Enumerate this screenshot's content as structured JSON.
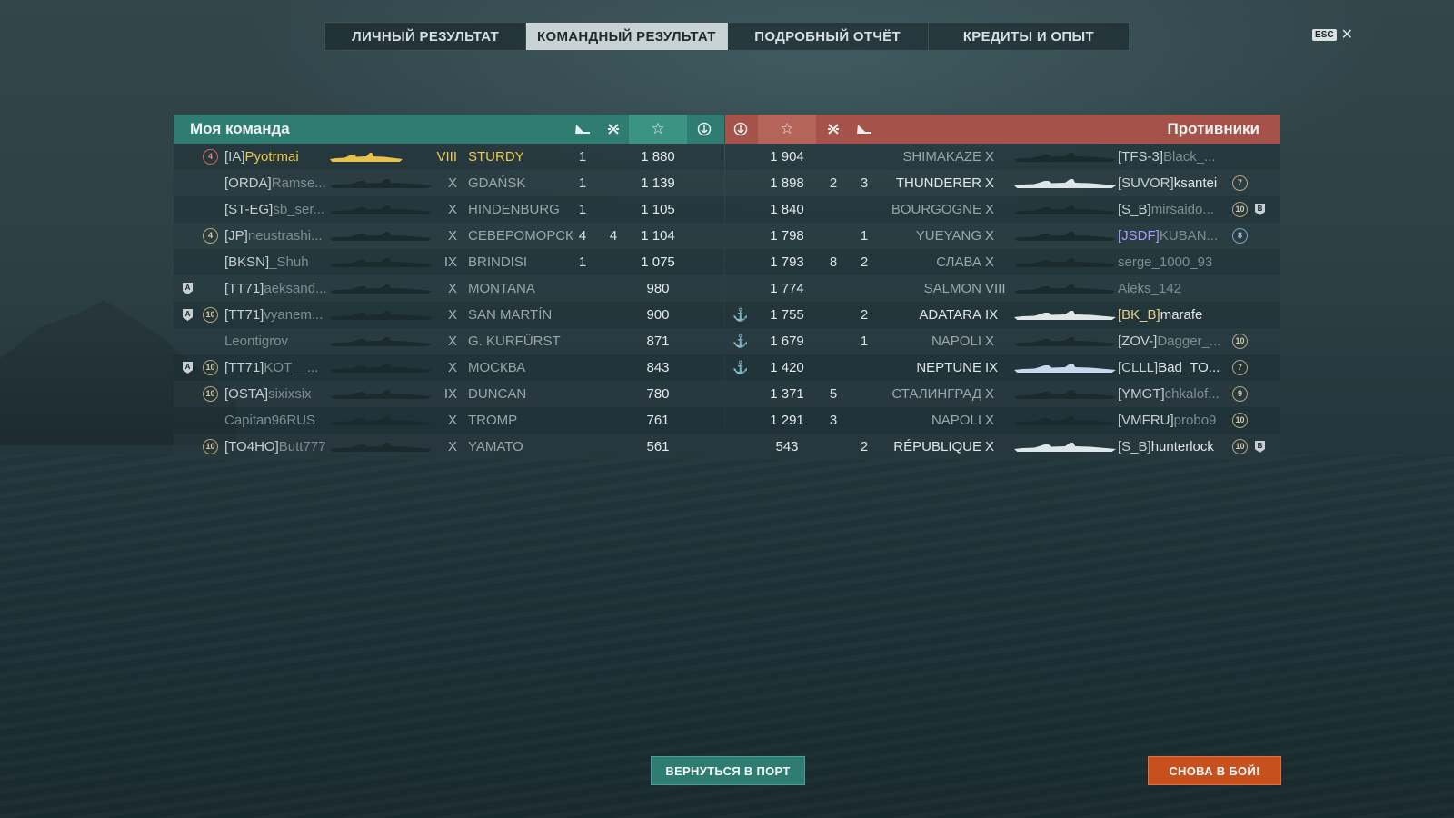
{
  "tabs": [
    {
      "label": "ЛИЧНЫЙ РЕЗУЛЬТАТ",
      "active": false
    },
    {
      "label": "КОМАНДНЫЙ РЕЗУЛЬТАТ",
      "active": true
    },
    {
      "label": "ПОДРОБНЫЙ ОТЧЁТ",
      "active": false
    },
    {
      "label": "КРЕДИТЫ И ОПЫТ",
      "active": false
    }
  ],
  "esc": {
    "key": "ESC",
    "close": "✕"
  },
  "my_team": {
    "title": "Моя команда",
    "color": "#2f7c72",
    "players": [
      {
        "clan": "[IA]",
        "name": "Pyotrmai",
        "tier": "VIII",
        "ship": "STURDY",
        "kills": "1",
        "planes": "",
        "score": "1 880",
        "medal": "4",
        "medal_style": "red",
        "badge": "",
        "self": true
      },
      {
        "clan": "[ORDA]",
        "name": "Ramse...",
        "tier": "X",
        "ship": "GDAŃSK",
        "kills": "1",
        "planes": "",
        "score": "1 139",
        "medal": "",
        "medal_style": "",
        "badge": "",
        "self": false
      },
      {
        "clan": "[ST-EG]",
        "name": "sb_ser...",
        "tier": "X",
        "ship": "HINDENBURG",
        "kills": "1",
        "planes": "",
        "score": "1 105",
        "medal": "",
        "medal_style": "",
        "badge": "",
        "self": false
      },
      {
        "clan": "[JP]",
        "name": "neustrashi...",
        "tier": "X",
        "ship": "СЕВЕРОМОРСК",
        "kills": "4",
        "planes": "4",
        "score": "1 104",
        "medal": "4",
        "medal_style": "",
        "badge": "",
        "self": false
      },
      {
        "clan": "[BKSN]",
        "name": "_Shuh",
        "tier": "IX",
        "ship": "BRINDISI",
        "kills": "1",
        "planes": "",
        "score": "1 075",
        "medal": "",
        "medal_style": "",
        "badge": "",
        "self": false
      },
      {
        "clan": "[TT71]",
        "name": "aeksand...",
        "tier": "X",
        "ship": "MONTANA",
        "kills": "",
        "planes": "",
        "score": "980",
        "medal": "",
        "medal_style": "",
        "badge": "A",
        "self": false
      },
      {
        "clan": "[TT71]",
        "name": "vyanem...",
        "tier": "X",
        "ship": "SAN MARTÍN",
        "kills": "",
        "planes": "",
        "score": "900",
        "medal": "10",
        "medal_style": "",
        "badge": "A",
        "self": false
      },
      {
        "clan": "",
        "name": "Leontigrov",
        "tier": "X",
        "ship": "G. KURFÜRST",
        "kills": "",
        "planes": "",
        "score": "871",
        "medal": "",
        "medal_style": "",
        "badge": "",
        "self": false
      },
      {
        "clan": "[TT71]",
        "name": "KOT__...",
        "tier": "X",
        "ship": "МОСКВА",
        "kills": "",
        "planes": "",
        "score": "843",
        "medal": "10",
        "medal_style": "",
        "badge": "A",
        "self": false
      },
      {
        "clan": "[OSTA]",
        "name": "sixixsix",
        "tier": "IX",
        "ship": "DUNCAN",
        "kills": "",
        "planes": "",
        "score": "780",
        "medal": "10",
        "medal_style": "",
        "badge": "",
        "self": false
      },
      {
        "clan": "",
        "name": "Capitan96RUS",
        "tier": "X",
        "ship": "TROMP",
        "kills": "",
        "planes": "",
        "score": "761",
        "medal": "",
        "medal_style": "",
        "badge": "",
        "self": false
      },
      {
        "clan": "[TO4HO]",
        "name": "Butt777",
        "tier": "X",
        "ship": "YAMATO",
        "kills": "",
        "planes": "",
        "score": "561",
        "medal": "10",
        "medal_style": "",
        "badge": "",
        "self": false
      }
    ]
  },
  "enemy_team": {
    "title": "Противники",
    "color": "#a5534a",
    "players": [
      {
        "score": "1 904",
        "planes": "",
        "kills": "",
        "ship": "SHIMAKAZE",
        "tier": "X",
        "clan": "[TFS-3]",
        "name": "Black_...",
        "medal": "",
        "medal_style": "",
        "badge": "",
        "anchor": false,
        "silhouette": "dark",
        "clan_style": ""
      },
      {
        "score": "1 898",
        "planes": "2",
        "kills": "3",
        "ship": "THUNDERER",
        "tier": "X",
        "clan": "[SUVOR]",
        "name": "ksantei",
        "medal": "7",
        "medal_style": "",
        "badge": "",
        "anchor": false,
        "silhouette": "light",
        "clan_style": ""
      },
      {
        "score": "1 840",
        "planes": "",
        "kills": "",
        "ship": "BOURGOGNE",
        "tier": "X",
        "clan": "[S_B]",
        "name": "mirsaido...",
        "medal": "10",
        "medal_style": "",
        "badge": "B",
        "anchor": false,
        "silhouette": "dark",
        "clan_style": ""
      },
      {
        "score": "1 798",
        "planes": "",
        "kills": "1",
        "ship": "YUEYANG",
        "tier": "X",
        "clan": "[JSDF]",
        "name": "KUBAN...",
        "medal": "8",
        "medal_style": "blue",
        "badge": "",
        "anchor": false,
        "silhouette": "dark",
        "clan_style": "purple"
      },
      {
        "score": "1 793",
        "planes": "8",
        "kills": "2",
        "ship": "СЛАВА",
        "tier": "X",
        "clan": "",
        "name": "serge_1000_93",
        "medal": "",
        "medal_style": "",
        "badge": "",
        "anchor": false,
        "silhouette": "dark",
        "clan_style": ""
      },
      {
        "score": "1 774",
        "planes": "",
        "kills": "",
        "ship": "SALMON",
        "tier": "VIII",
        "clan": "",
        "name": "Aleks_142",
        "medal": "",
        "medal_style": "",
        "badge": "",
        "anchor": false,
        "silhouette": "dark",
        "clan_style": ""
      },
      {
        "score": "1 755",
        "planes": "",
        "kills": "2",
        "ship": "ADATARA",
        "tier": "IX",
        "clan": "[BK_B]",
        "name": "marafe",
        "medal": "",
        "medal_style": "",
        "badge": "",
        "anchor": true,
        "silhouette": "light",
        "clan_style": "gold"
      },
      {
        "score": "1 679",
        "planes": "",
        "kills": "1",
        "ship": "NAPOLI",
        "tier": "X",
        "clan": "[ZOV-]",
        "name": "Dagger_...",
        "medal": "10",
        "medal_style": "",
        "badge": "",
        "anchor": true,
        "silhouette": "dark",
        "clan_style": ""
      },
      {
        "score": "1 420",
        "planes": "",
        "kills": "",
        "ship": "NEPTUNE",
        "tier": "IX",
        "clan": "[CLLL]",
        "name": "Bad_TO...",
        "medal": "7",
        "medal_style": "",
        "badge": "",
        "anchor": true,
        "silhouette": "blue",
        "clan_style": ""
      },
      {
        "score": "1 371",
        "planes": "5",
        "kills": "",
        "ship": "СТАЛИНГРАД",
        "tier": "X",
        "clan": "[YMGT]",
        "name": "chkalof...",
        "medal": "9",
        "medal_style": "",
        "badge": "",
        "anchor": false,
        "silhouette": "dark",
        "clan_style": ""
      },
      {
        "score": "1 291",
        "planes": "3",
        "kills": "",
        "ship": "NAPOLI",
        "tier": "X",
        "clan": "[VMFRU]",
        "name": "probo9",
        "medal": "10",
        "medal_style": "",
        "badge": "",
        "anchor": false,
        "silhouette": "dark",
        "clan_style": ""
      },
      {
        "score": "543",
        "planes": "",
        "kills": "2",
        "ship": "RÉPUBLIQUE",
        "tier": "X",
        "clan": "[S_B]",
        "name": "hunterlock",
        "medal": "10",
        "medal_style": "",
        "badge": "B",
        "anchor": false,
        "silhouette": "light",
        "clan_style": ""
      }
    ]
  },
  "header_icons": {
    "kills": "ship-kill-icon",
    "planes": "plane-kill-icon",
    "score": "☆",
    "anchor": "anchor-icon"
  },
  "buttons": {
    "port": "ВЕРНУТЬСЯ В ПОРТ",
    "battle": "СНОВА В БОЙ!"
  },
  "colors": {
    "self": "#f0c84a",
    "battle_button": "#c8501e",
    "port_button": "#2f7c72"
  }
}
